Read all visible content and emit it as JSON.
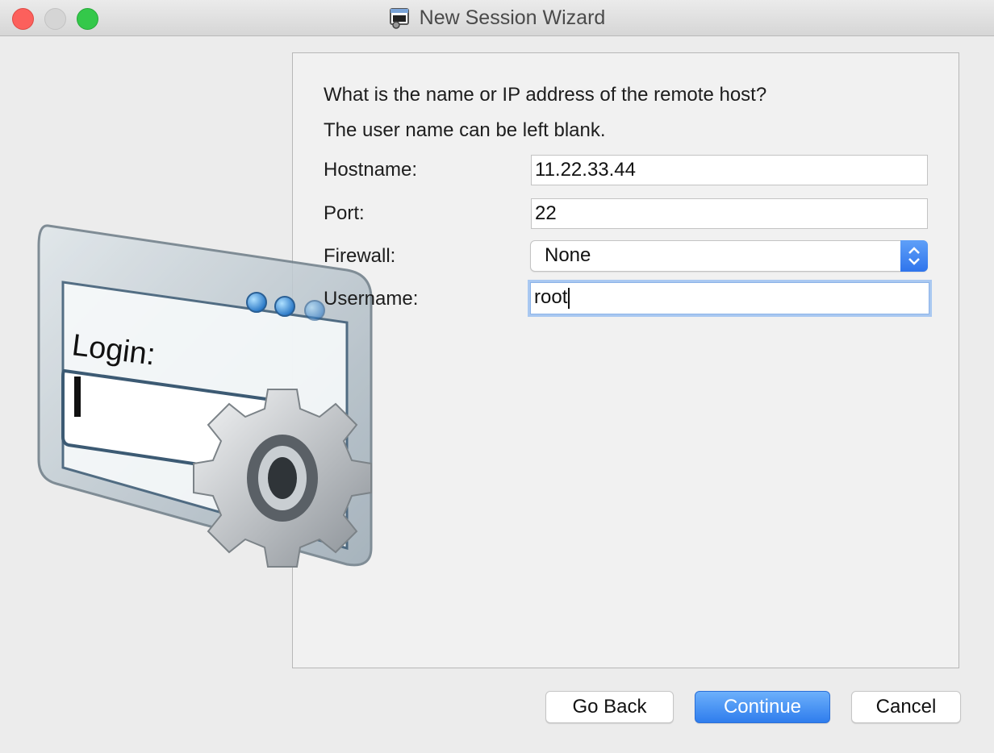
{
  "window": {
    "title": "New Session Wizard",
    "icon": "terminal-window-icon"
  },
  "wizard": {
    "question": "What is the name or IP address of the remote host?",
    "note": "The user name can be left blank.",
    "illustration": {
      "label": "Login:",
      "icon": "login-gear-illustration"
    },
    "fields": {
      "hostname": {
        "label": "Hostname:",
        "value": "11.22.33.44"
      },
      "port": {
        "label": "Port:",
        "value": "22"
      },
      "firewall": {
        "label": "Firewall:",
        "value": "None"
      },
      "username": {
        "label": "Username:",
        "value": "root"
      }
    }
  },
  "buttons": {
    "go_back": "Go Back",
    "continue": "Continue",
    "cancel": "Cancel"
  },
  "colors": {
    "accent": "#3b82f0",
    "close": "#fc605c",
    "maximize": "#34c84a"
  }
}
